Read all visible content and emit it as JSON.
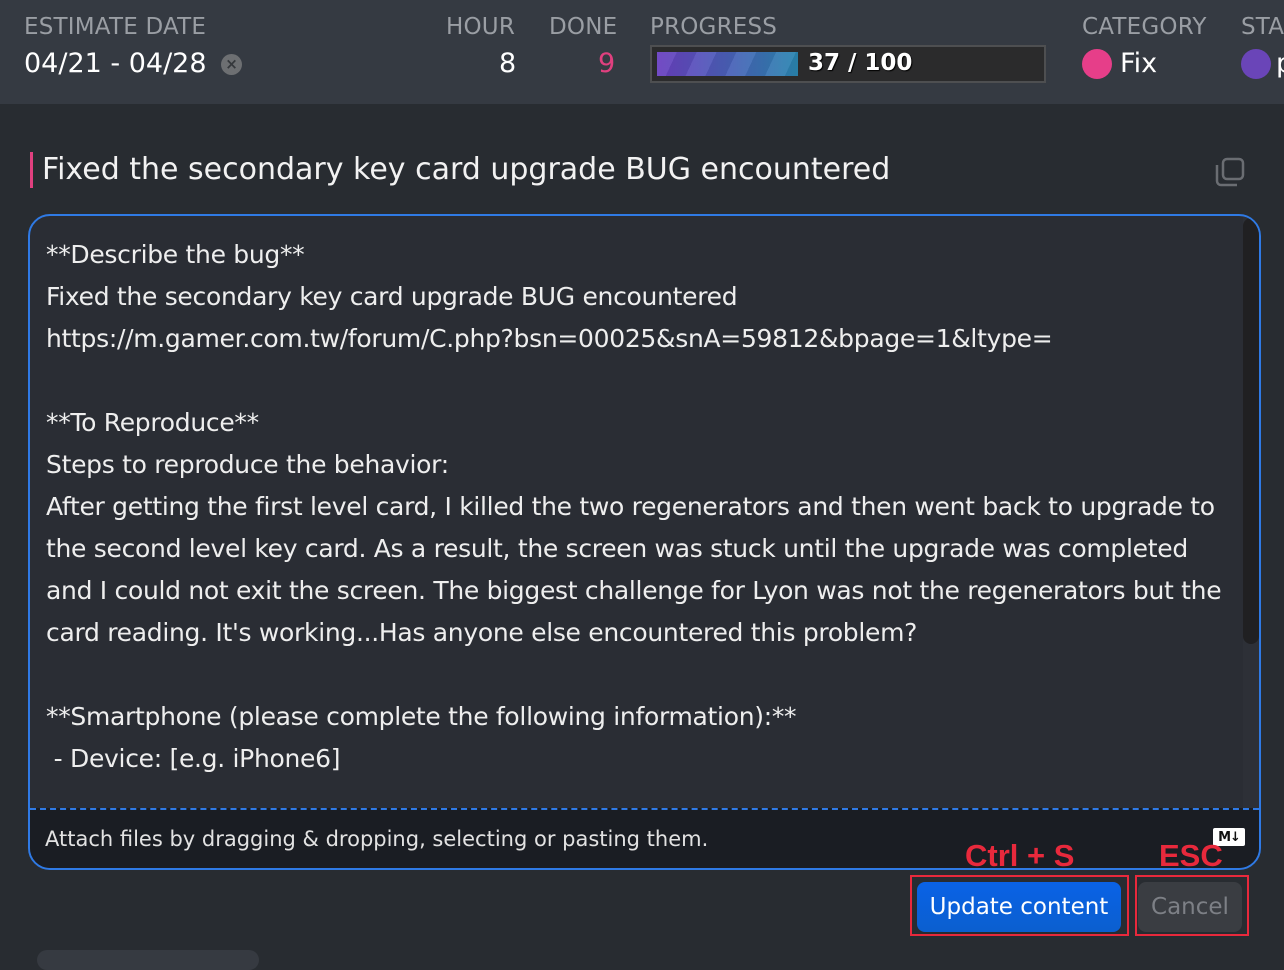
{
  "header": {
    "estimate_date": {
      "label": "ESTIMATE DATE",
      "value": "04/21 - 04/28",
      "clear_icon": "close-circle-icon",
      "clear_glyph": "×"
    },
    "hour": {
      "label": "HOUR",
      "value": "8"
    },
    "done": {
      "label": "DONE",
      "value": "9",
      "color": "#e0407f"
    },
    "progress": {
      "label": "PROGRESS",
      "current": 37,
      "total": 100,
      "text": "37 / 100",
      "percent": 37
    },
    "category": {
      "label": "CATEGORY",
      "value": "Fix",
      "color": "#e63e89"
    },
    "status": {
      "label": "STA",
      "color": "#6a45b8",
      "value_partial": "p"
    }
  },
  "task": {
    "title": "Fixed the secondary key card upgrade BUG encountered",
    "copy_icon": "copy-icon"
  },
  "editor": {
    "content": "**Describe the bug**\nFixed the secondary key card upgrade BUG encountered\nhttps://m.gamer.com.tw/forum/C.php?bsn=00025&snA=59812&bpage=1&ltype=\n\n**To Reproduce**\nSteps to reproduce the behavior:\nAfter getting the first level card, I killed the two regenerators and then went back to upgrade to the second level key card. As a result, the screen was stuck until the upgrade was completed and I could not exit the screen. The biggest challenge for Lyon was not the regenerators but the card reading. It's working...Has anyone else encountered this problem?\n\n**Smartphone (please complete the following information):**\n - Device: [e.g. iPhone6]",
    "attach_text": "Attach files by dragging & dropping, selecting or pasting them.",
    "markdown_badge": "M↓"
  },
  "actions": {
    "update_label": "Update content",
    "update_shortcut": "Ctrl + S",
    "cancel_label": "Cancel",
    "cancel_shortcut": "ESC"
  }
}
